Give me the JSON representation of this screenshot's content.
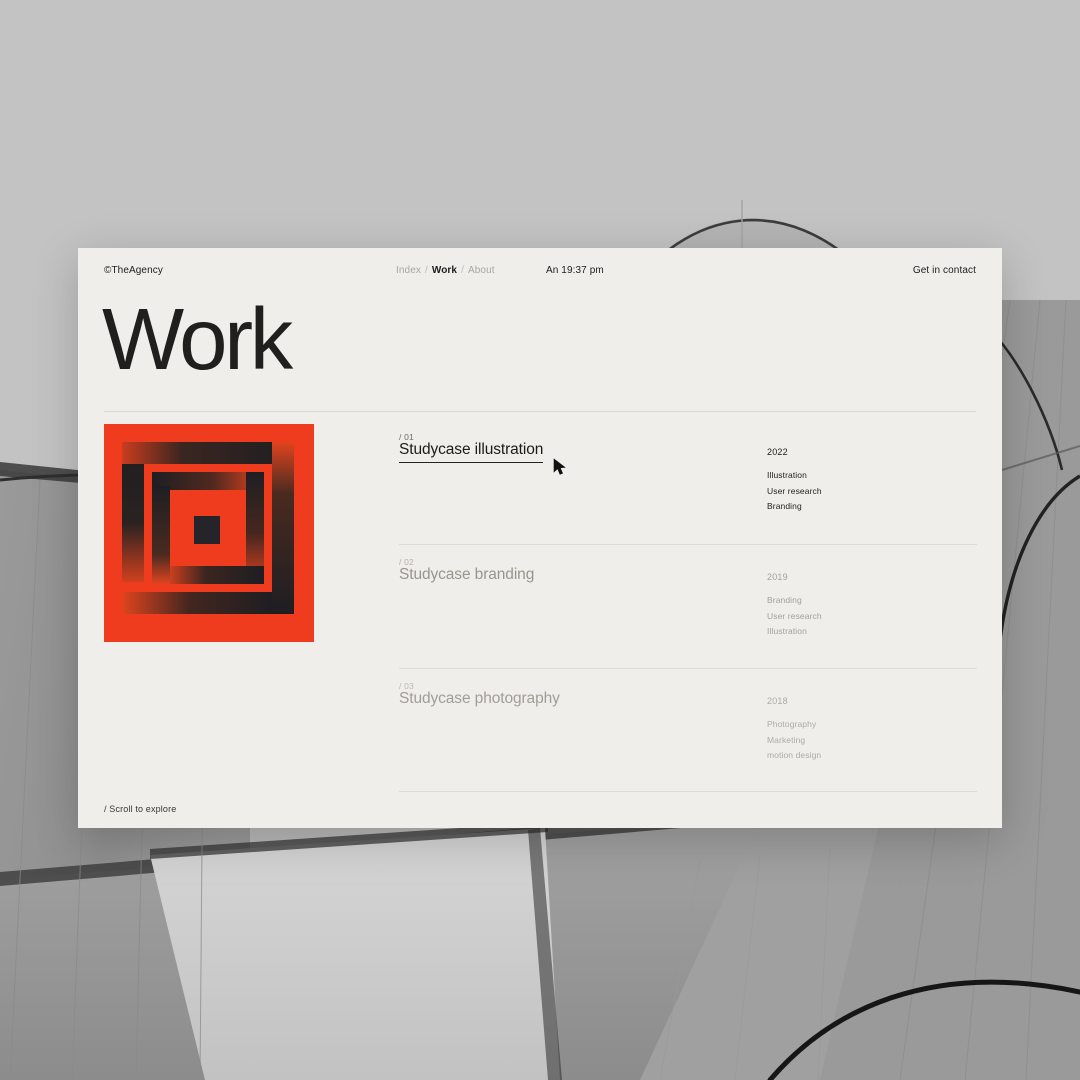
{
  "header": {
    "brand": "©TheAgency",
    "nav": [
      {
        "label": "Index",
        "active": false
      },
      {
        "label": "Work",
        "active": true
      },
      {
        "label": "About",
        "active": false
      }
    ],
    "separator": "/",
    "clock": "An 19:37 pm",
    "contact_label": "Get in contact"
  },
  "main": {
    "page_title": "Work",
    "artwork": {
      "name": "spiral-square-artwork",
      "background_color": "#f03c1e",
      "bar_color": "#1e1e22"
    },
    "projects": [
      {
        "index": "/ 01",
        "title": "Studycase illustration",
        "year": "2022",
        "tags": [
          "Illustration",
          "User research",
          "Branding"
        ],
        "state": "active"
      },
      {
        "index": "/ 02",
        "title": "Studycase branding",
        "year": "2019",
        "tags": [
          "Branding",
          "User research",
          "Illustration"
        ],
        "state": "dim"
      },
      {
        "index": "/ 03",
        "title": "Studycase photography",
        "year": "2018",
        "tags": [
          "Photography",
          "Marketing",
          "motion design"
        ],
        "state": "dimmer"
      }
    ]
  },
  "footer": {
    "scroll_hint": "/ Scroll to explore"
  },
  "colors": {
    "card_background": "#efeeea",
    "photo_background": "#b9b9b9",
    "ink": "#1d1d1f",
    "muted": "#a9a79f",
    "accent_red": "#f03c1e",
    "rule": "#dedcd5"
  }
}
